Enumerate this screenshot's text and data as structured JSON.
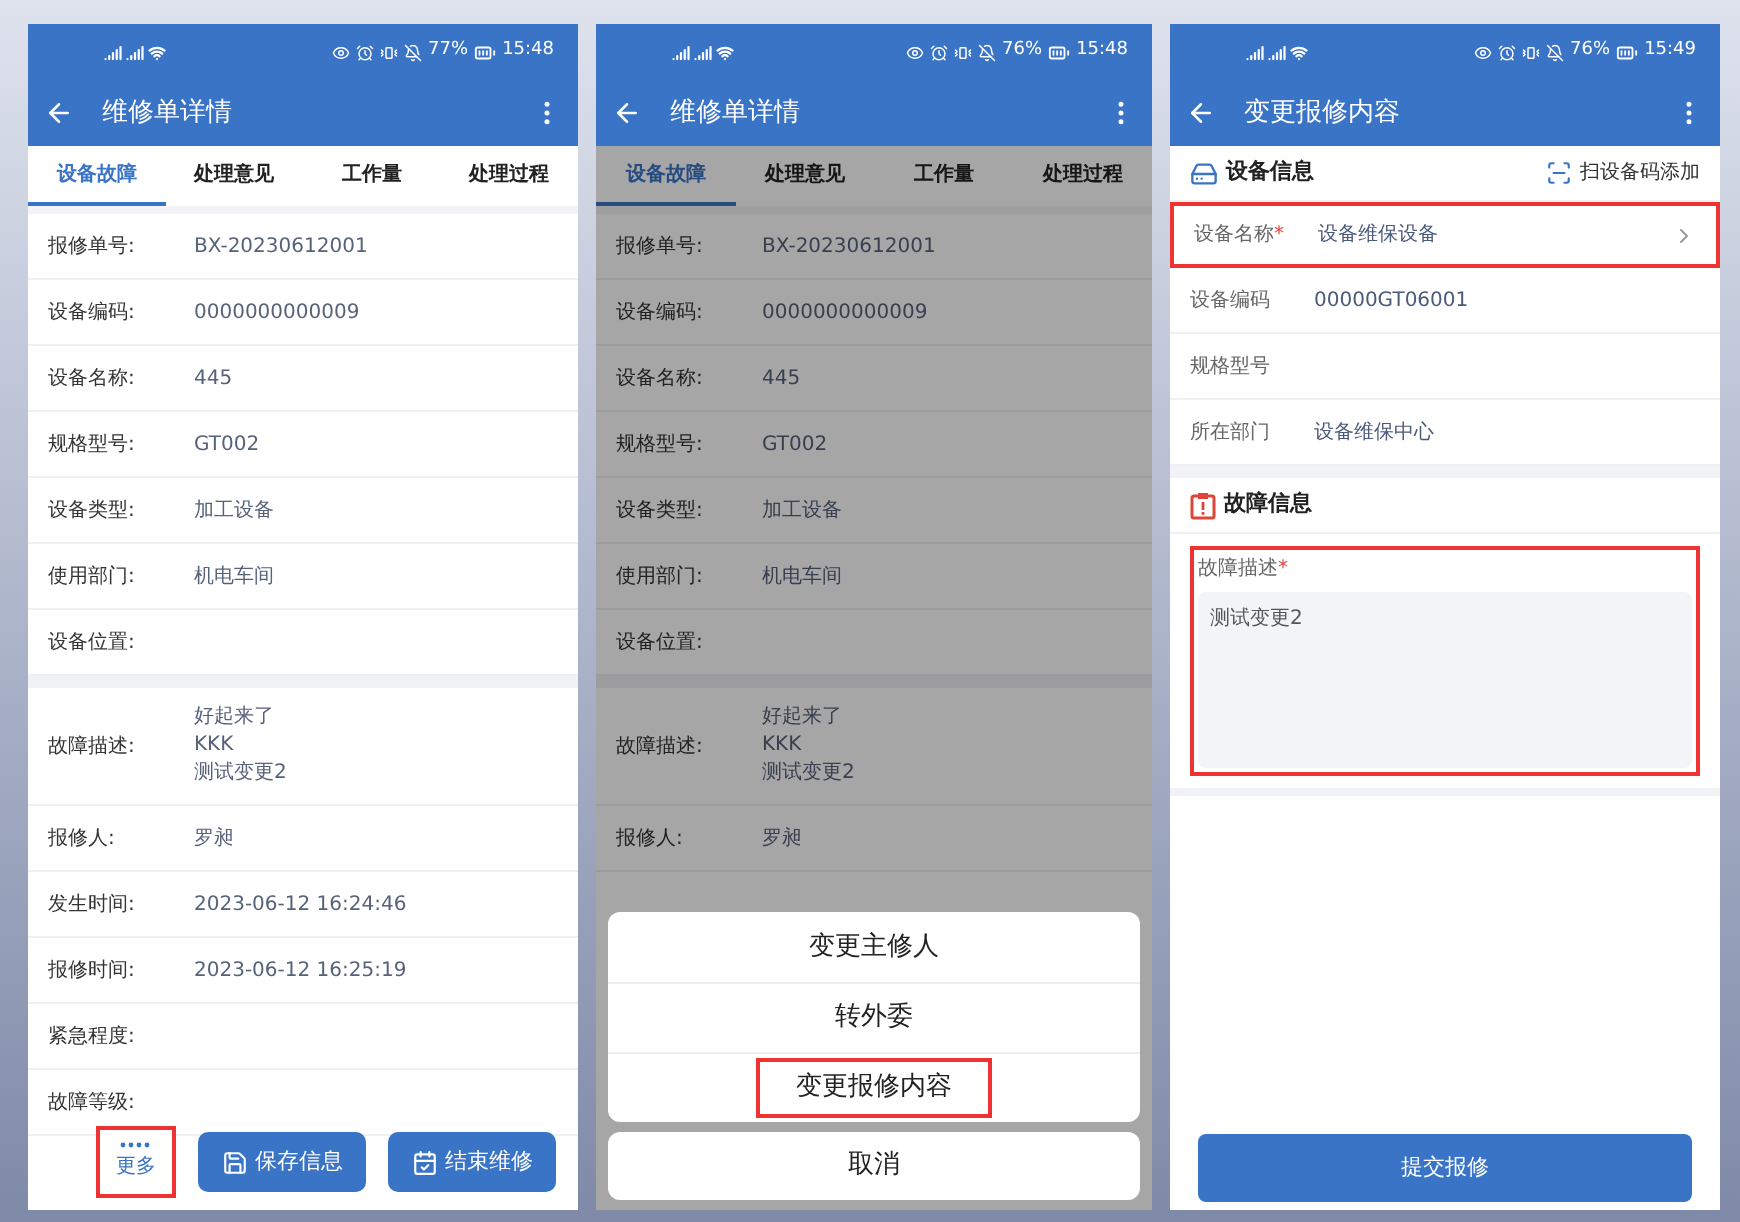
{
  "screens": [
    {
      "kind": "detail",
      "status_bar": {
        "battery": "77%",
        "time": "15:48"
      },
      "title": "维修单详情",
      "tabs": [
        {
          "label": "设备故障",
          "selected": true
        },
        {
          "label": "处理意见",
          "selected": false
        },
        {
          "label": "工作量",
          "selected": false
        },
        {
          "label": "处理过程",
          "selected": false
        }
      ],
      "sections": [
        [
          {
            "label": "报修单号:",
            "value": "BX-20230612001"
          },
          {
            "label": "设备编码:",
            "value": "0000000000009"
          },
          {
            "label": "设备名称:",
            "value": "445"
          },
          {
            "label": "规格型号:",
            "value": "GT002"
          },
          {
            "label": "设备类型:",
            "value": "加工设备"
          },
          {
            "label": "使用部门:",
            "value": "机电车间"
          },
          {
            "label": "设备位置:"
          }
        ],
        [
          {
            "label": "故障描述:",
            "lines": [
              "好起来了",
              "KKK",
              "测试变更2"
            ]
          },
          {
            "label": "报修人:",
            "value": "罗昶"
          },
          {
            "label": "发生时间:",
            "value": "2023-06-12 16:24:46"
          },
          {
            "label": "报修时间:",
            "value": "2023-06-12 16:25:19"
          },
          {
            "label": "紧急程度:"
          },
          {
            "label": "故障等级:"
          }
        ]
      ],
      "bottom_bar": {
        "more": {
          "label": "更多",
          "highlighted": true
        },
        "buttons": [
          {
            "kind": "save",
            "label": "保存信息"
          },
          {
            "kind": "finish",
            "label": "结束维修"
          }
        ]
      }
    },
    {
      "kind": "detail",
      "status_bar": {
        "battery": "76%",
        "time": "15:48"
      },
      "title": "维修单详情",
      "tabs": [
        {
          "label": "设备故障",
          "selected": true
        },
        {
          "label": "处理意见",
          "selected": false
        },
        {
          "label": "工作量",
          "selected": false
        },
        {
          "label": "处理过程",
          "selected": false
        }
      ],
      "sections": [
        [
          {
            "label": "报修单号:",
            "value": "BX-20230612001"
          },
          {
            "label": "设备编码:",
            "value": "0000000000009"
          },
          {
            "label": "设备名称:",
            "value": "445"
          },
          {
            "label": "规格型号:",
            "value": "GT002"
          },
          {
            "label": "设备类型:",
            "value": "加工设备"
          },
          {
            "label": "使用部门:",
            "value": "机电车间"
          },
          {
            "label": "设备位置:"
          }
        ],
        [
          {
            "label": "故障描述:",
            "lines": [
              "好起来了",
              "KKK",
              "测试变更2"
            ]
          },
          {
            "label": "报修人:",
            "value": "罗昶"
          }
        ]
      ],
      "action_sheet": {
        "items": [
          {
            "label": "变更主修人",
            "highlighted": false
          },
          {
            "label": "转外委",
            "highlighted": false
          },
          {
            "label": "变更报修内容",
            "highlighted": true
          }
        ],
        "cancel": "取消"
      }
    },
    {
      "kind": "form",
      "status_bar": {
        "battery": "76%",
        "time": "15:49"
      },
      "title": "变更报修内容",
      "sections": [
        {
          "kind": "device",
          "title": "设备信息",
          "action": "扫设备码添加",
          "rows": [
            {
              "label": "设备名称",
              "required_mark": "*",
              "value": "设备维保设备",
              "select": true,
              "highlighted": true
            },
            {
              "label": "设备编码",
              "value": "00000GT06001",
              "select": false,
              "highlighted": false
            },
            {
              "label": "规格型号",
              "select": false,
              "highlighted": false
            },
            {
              "label": "所在部门",
              "value": "设备维保中心",
              "select": false,
              "highlighted": false
            }
          ]
        },
        {
          "kind": "fault",
          "title": "故障信息",
          "field": {
            "label": "故障描述",
            "required_mark": "*",
            "value": "测试变更2",
            "highlighted": true
          }
        }
      ],
      "submit": "提交报修"
    }
  ]
}
